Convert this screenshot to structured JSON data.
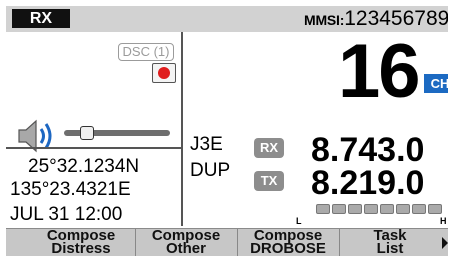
{
  "status_bar": {
    "mode_tag": "RX",
    "mmsi_label": "MMSI:",
    "mmsi_value": "123456789"
  },
  "left_panel": {
    "dsc_indicator": "DSC (1)",
    "record_icon": "record-dot-icon",
    "speaker_icon": "speaker-volume-icon",
    "volume_level": 0.17,
    "latitude": "25°32.1234N",
    "longitude": "135°23.4321E",
    "datetime": "JUL 31 12:00"
  },
  "channel": {
    "number": "16",
    "tag": "CH"
  },
  "radio": {
    "mode": "J3E",
    "duplex": "DUP",
    "rx_badge": "RX",
    "tx_badge": "TX",
    "rx_frequency": "8.743.0",
    "tx_frequency": "8.219.0"
  },
  "signal_meter": {
    "segments": 8,
    "level": 0,
    "low_label": "L",
    "high_label": "H"
  },
  "softkeys": [
    {
      "line1": "Compose",
      "line2": "Distress"
    },
    {
      "line1": "Compose",
      "line2": "Other"
    },
    {
      "line1": "Compose",
      "line2": "DROBOSE"
    },
    {
      "line1": "Task",
      "line2": "List"
    }
  ],
  "colors": {
    "channel_tag": "#1c6ac2",
    "record_dot": "#e01d1d",
    "status_bar": "#d2d2d2",
    "softkey_bar": "#c7c7c7"
  }
}
